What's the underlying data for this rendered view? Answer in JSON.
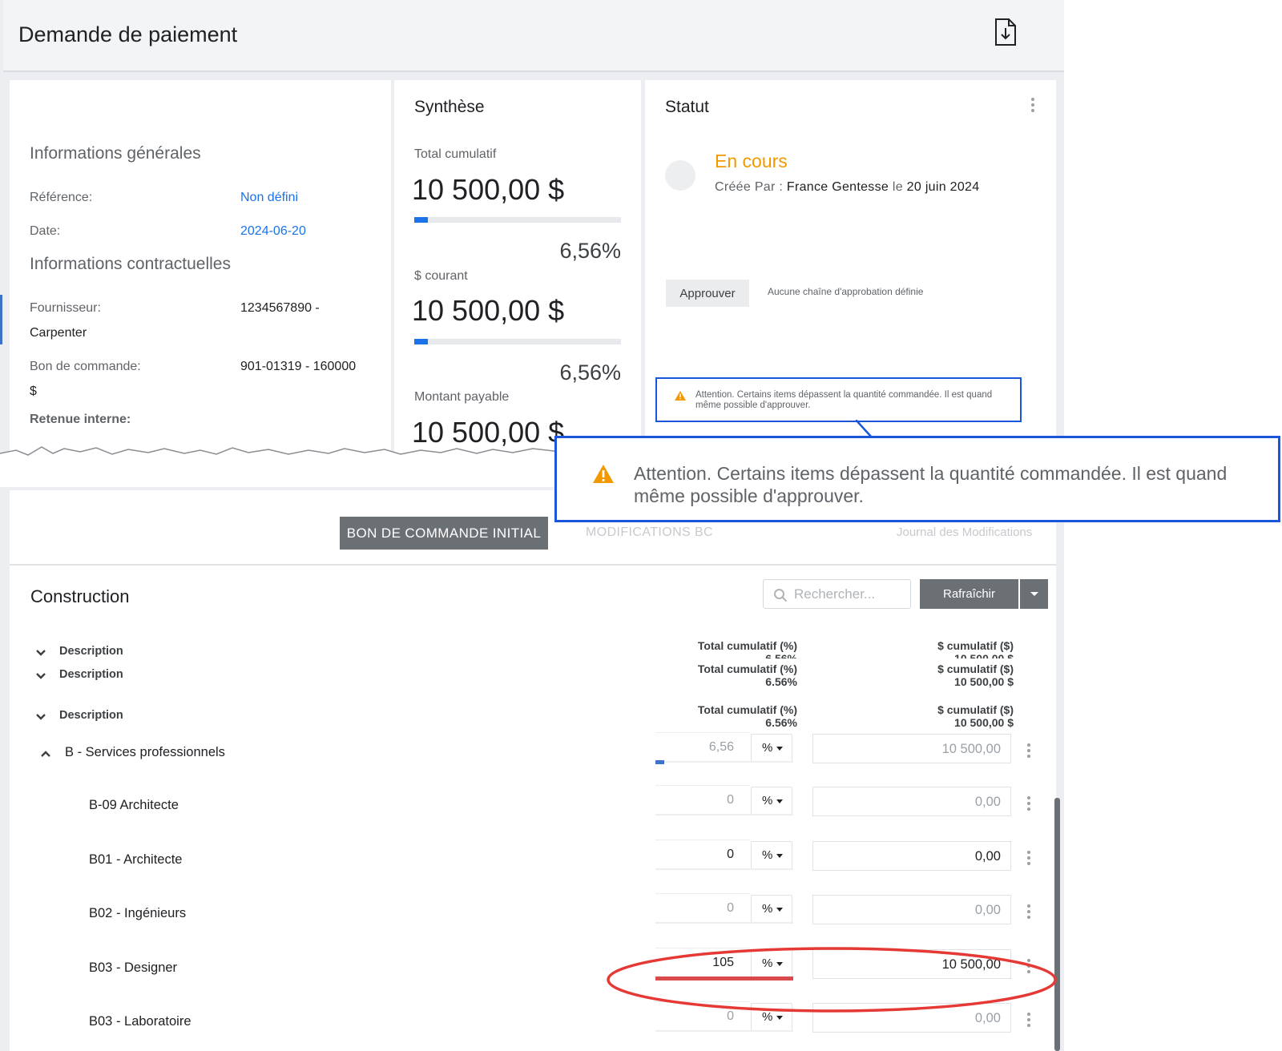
{
  "header": {
    "title": "Demande de paiement",
    "download_icon": "file-download-icon"
  },
  "general_info": {
    "title": "Informations générales",
    "reference_label": "Référence:",
    "reference_value": "Non défini",
    "date_label": "Date:",
    "date_value": "2024-06-20"
  },
  "contract_info": {
    "title": "Informations contractuelles",
    "supplier_label": "Fournisseur:",
    "supplier_value": "1234567890 -",
    "supplier_value_cont": "Carpenter",
    "po_label": "Bon de commande:",
    "po_value": "901-01319 - 160000",
    "po_value_cont": "$",
    "retention_label": "Retenue interne:"
  },
  "synthesis": {
    "title": "Synthèse",
    "cumulative_label": "Total cumulatif",
    "cumulative_amount": "10 500,00 $",
    "cumulative_pct": "6,56%",
    "cumulative_progress": 0.0656,
    "current_label": "$ courant",
    "current_amount": "10 500,00 $",
    "current_pct": "6,56%",
    "current_progress": 0.0656,
    "payable_label": "Montant payable",
    "payable_amount": "10 500,00 $"
  },
  "status": {
    "title": "Statut",
    "state": "En cours",
    "created_by_label": "Créée Par :",
    "created_by": "France Gentesse",
    "on_label": "le",
    "created_date": "20 juin 2024",
    "approve_label": "Approuver",
    "no_chain": "Aucune chaîne d'approbation définie",
    "warning": "Attention. Certains items dépassent la quantité commandée. Il est quand même possible d'approuver."
  },
  "callout": {
    "text": "Attention. Certains items dépassent la quantité commandée. Il est quand même possible d'approuver."
  },
  "tabs": [
    {
      "label": "BON DE COMMANDE INITIAL"
    },
    {
      "label": "MODIFICATIONS BC"
    },
    {
      "label": "Journal des Modifications"
    }
  ],
  "construction": {
    "title": "Construction",
    "search_placeholder": "Rechercher...",
    "refresh_label": "Rafraîchir",
    "groups": [
      {
        "label": "Description",
        "pct_header": "Total cumulatif (%)",
        "pct_value": "6.56%",
        "amt_header": "$ cumulatif ($)",
        "amt_value": "10 500,00 $"
      },
      {
        "label": "Description",
        "pct_header": "Total cumulatif (%)",
        "pct_value": "6.56%",
        "amt_header": "$ cumulatif ($)",
        "amt_value": "10 500,00 $"
      },
      {
        "label": "Description",
        "pct_header": "Total cumulatif (%)",
        "pct_value": "6.56%",
        "amt_header": "$ cumulatif ($)",
        "amt_value": "10 500,00 $"
      }
    ],
    "section": {
      "label": "B - Services professionnels",
      "pct": "6,56",
      "unit": "%",
      "amount": "10 500,00",
      "progress": 0.0656
    },
    "rows": [
      {
        "label": "B-09 Architecte",
        "pct": "0",
        "unit": "%",
        "amount": "0,00"
      },
      {
        "label": "B01 - Architecte",
        "pct": "0",
        "unit": "%",
        "amount": "0,00"
      },
      {
        "label": "B02 - Ingénieurs",
        "pct": "0",
        "unit": "%",
        "amount": "0,00"
      },
      {
        "label": "B03 - Designer",
        "pct": "105",
        "unit": "%",
        "amount": "10 500,00"
      },
      {
        "label": "B03 - Laboratoire",
        "pct": "0",
        "unit": "%",
        "amount": "0,00"
      }
    ]
  },
  "colors": {
    "accent": "#1a73e8",
    "status": "#f29900",
    "callout_border": "#1a56db",
    "highlight": "#e53935",
    "button": "#6b7075"
  }
}
